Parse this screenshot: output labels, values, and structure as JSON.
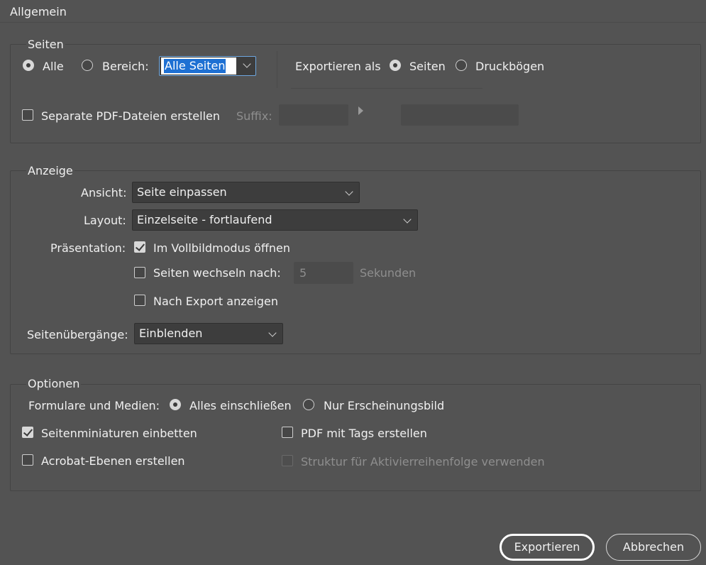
{
  "header": {
    "title": "Allgemein"
  },
  "seiten": {
    "title": "Seiten",
    "alle_label": "Alle",
    "bereich_label": "Bereich:",
    "bereich_value": "Alle Seiten",
    "export_as_label": "Exportieren als",
    "seiten_option": "Seiten",
    "druckboegen_option": "Druckbögen",
    "separate_pdf_label": "Separate PDF-Dateien erstellen",
    "suffix_label": "Suffix:"
  },
  "anzeige": {
    "title": "Anzeige",
    "ansicht_label": "Ansicht:",
    "ansicht_value": "Seite einpassen",
    "layout_label": "Layout:",
    "layout_value": "Einzelseite - fortlaufend",
    "praesentation_label": "Präsentation:",
    "vollbild_label": "Im Vollbildmodus öffnen",
    "wechseln_label": "Seiten wechseln nach:",
    "wechseln_value": "5",
    "sekunden_label": "Sekunden",
    "nach_export_label": "Nach Export anzeigen",
    "uebergaenge_label": "Seitenübergänge:",
    "uebergaenge_value": "Einblenden"
  },
  "optionen": {
    "title": "Optionen",
    "formulare_label": "Formulare und Medien:",
    "alles_label": "Alles einschließen",
    "nur_label": "Nur Erscheinungsbild",
    "miniaturen_label": "Seitenminiaturen einbetten",
    "tags_label": "PDF mit Tags erstellen",
    "ebenen_label": "Acrobat-Ebenen erstellen",
    "struktur_label": "Struktur für Aktivierreihenfolge verwenden"
  },
  "footer": {
    "export_label": "Exportieren",
    "cancel_label": "Abbrechen"
  }
}
